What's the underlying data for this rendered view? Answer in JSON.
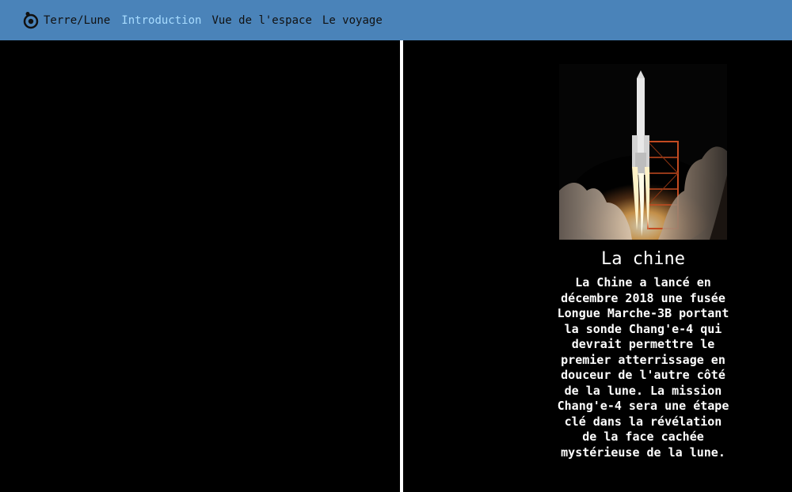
{
  "navbar": {
    "brand_label": "Terre/Lune",
    "links": [
      {
        "label": "Introduction",
        "active": true
      },
      {
        "label": "Vue de l'espace",
        "active": false
      },
      {
        "label": "Le voyage",
        "active": false
      }
    ],
    "background": "#4a83b9",
    "active_color": "#a8dcff"
  },
  "main": {
    "card": {
      "image_icon": "rocket-launch-photo",
      "title": "La chine",
      "text": "La Chine a lancé en décembre 2018 une fusée Longue Marche-3B portant la sonde Chang'e-4 qui devrait permettre le premier atterrissage en douceur de l'autre côté de la lune. La mission Chang'e-4 sera une étape clé dans la révélation de la face cachée mystérieuse de la lune."
    }
  }
}
